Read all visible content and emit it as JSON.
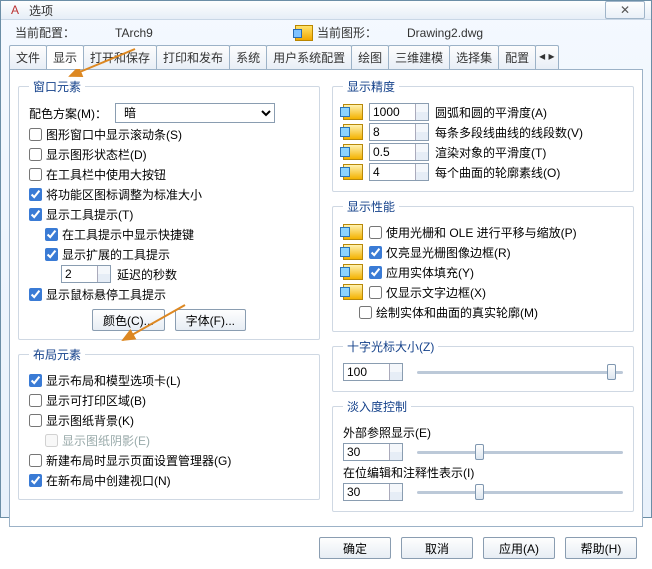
{
  "title": "选项",
  "config": {
    "currentLabel": "当前配置：",
    "currentValue": "TArch9",
    "drawingLabel": "当前图形：",
    "drawingValue": "Drawing2.dwg"
  },
  "tabs": [
    "文件",
    "显示",
    "打开和保存",
    "打印和发布",
    "系统",
    "用户系统配置",
    "绘图",
    "三维建模",
    "选择集",
    "配置"
  ],
  "activeTab": 1,
  "winElem": {
    "legend": "窗口元素",
    "schemeLabel": "配色方案(M)：",
    "schemeValue": "暗",
    "c1": "图形窗口中显示滚动条(S)",
    "c2": "显示图形状态栏(D)",
    "c3": "在工具栏中使用大按钮",
    "c4": "将功能区图标调整为标准大小",
    "c5": "显示工具提示(T)",
    "c6": "在工具提示中显示快捷键",
    "c7": "显示扩展的工具提示",
    "delayVal": "2",
    "delayLbl": "延迟的秒数",
    "c8": "显示鼠标悬停工具提示",
    "colorBtn": "颜色(C)...",
    "fontBtn": "字体(F)..."
  },
  "layout": {
    "legend": "布局元素",
    "l1": "显示布局和模型选项卡(L)",
    "l2": "显示可打印区域(B)",
    "l3": "显示图纸背景(K)",
    "l4": "显示图纸阴影(E)",
    "l5": "新建布局时显示页面设置管理器(G)",
    "l6": "在新布局中创建视口(N)"
  },
  "precision": {
    "legend": "显示精度",
    "v1": "1000",
    "t1": "圆弧和圆的平滑度(A)",
    "v2": "8",
    "t2": "每条多段线曲线的线段数(V)",
    "v3": "0.5",
    "t3": "渲染对象的平滑度(T)",
    "v4": "4",
    "t4": "每个曲面的轮廓素线(O)"
  },
  "perf": {
    "legend": "显示性能",
    "p1": "使用光栅和 OLE 进行平移与缩放(P)",
    "p2": "仅亮显光栅图像边框(R)",
    "p3": "应用实体填充(Y)",
    "p4": "仅显示文字边框(X)",
    "p5": "绘制实体和曲面的真实轮廓(M)"
  },
  "cursor": {
    "legend": "十字光标大小(Z)",
    "value": "100"
  },
  "fade": {
    "legend": "淡入度控制",
    "f1": "外部参照显示(E)",
    "v1": "30",
    "f2": "在位编辑和注释性表示(I)",
    "v2": "30"
  },
  "buttons": {
    "ok": "确定",
    "cancel": "取消",
    "apply": "应用(A)",
    "help": "帮助(H)"
  }
}
